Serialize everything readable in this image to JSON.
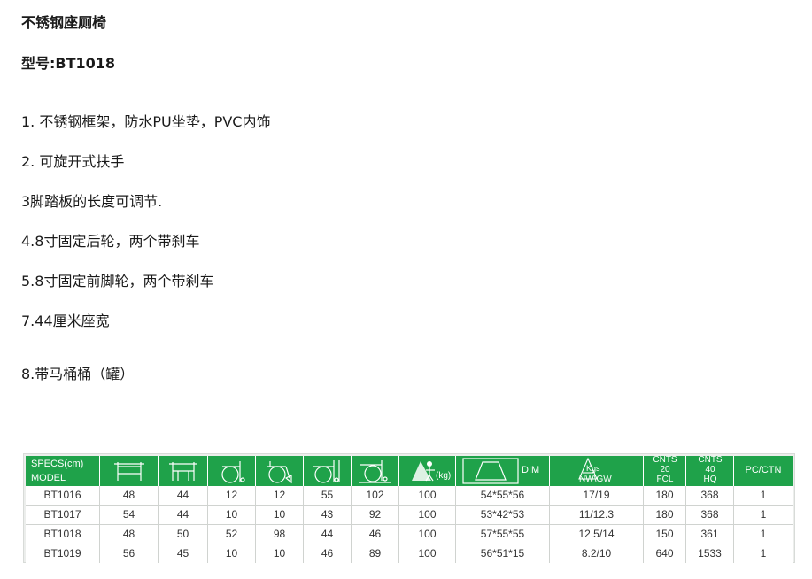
{
  "title": "不锈钢座厕椅",
  "model_line": "型号:BT1018",
  "features": [
    "1. 不锈钢框架，防水PU坐垫，PVC内饰",
    "2. 可旋开式扶手",
    "3脚踏板的长度可调节.",
    "4.8寸固定后轮，两个带刹车",
    "5.8寸固定前脚轮，两个带刹车",
    "7.44厘米座宽",
    "8.带马桶桶（罐）"
  ],
  "specs_table": {
    "header": {
      "specs": "SPECS(cm)",
      "model": "MODEL",
      "weight_unit": "(kg)",
      "dim": "DIM",
      "kgs": "Kgs",
      "nwgw": "NW\\GW",
      "cnts20": [
        "CNTS",
        "20",
        "FCL"
      ],
      "cnts40": [
        "CNTS",
        "40",
        "HQ"
      ],
      "pcctn": "PC/CTN"
    },
    "header_icons": [
      "overall-width-icon",
      "seat-width-icon",
      "seat-height-icon",
      "seat-depth-icon",
      "overall-height-icon",
      "overall-length-icon",
      "max-weight-icon",
      "carton-dimension-icon",
      "weight-triangle-icon"
    ],
    "rows": [
      [
        "BT1016",
        "48",
        "44",
        "12",
        "12",
        "55",
        "102",
        "100",
        "54*55*56",
        "17/19",
        "180",
        "368",
        "1"
      ],
      [
        "BT1017",
        "54",
        "44",
        "10",
        "10",
        "43",
        "92",
        "100",
        "53*42*53",
        "11/12.3",
        "180",
        "368",
        "1"
      ],
      [
        "BT1018",
        "48",
        "50",
        "52",
        "98",
        "44",
        "46",
        "100",
        "57*55*55",
        "12.5/14",
        "150",
        "361",
        "1"
      ],
      [
        "BT1019",
        "56",
        "45",
        "10",
        "10",
        "46",
        "89",
        "100",
        "56*51*15",
        "8.2/10",
        "640",
        "1533",
        "1"
      ]
    ],
    "colors": {
      "header_bg": "#1fa24a",
      "header_text": "#ffffff",
      "table_bg": "#eceeec"
    }
  }
}
